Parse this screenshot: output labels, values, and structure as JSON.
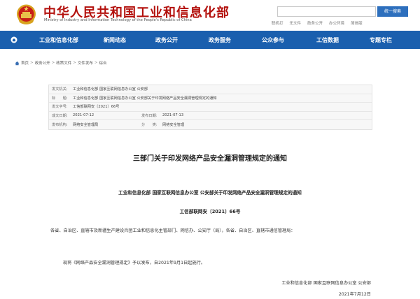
{
  "header": {
    "title": "中华人民共和国工业和信息化部",
    "subtitle": "Ministry of Industry and Information Technology of the People's Republic of China",
    "search_placeholder": "",
    "search_button": "统一搜索",
    "top_links": [
      "联机打",
      "无文件",
      "政务公开",
      "办公环境",
      "简体版"
    ]
  },
  "nav": {
    "items": [
      "工业和信息化部",
      "新闻动态",
      "政务公开",
      "政务服务",
      "公众参与",
      "工信数据",
      "专题专栏"
    ]
  },
  "breadcrumb": [
    "首页",
    "政务公开",
    "政策文件",
    "文件发布",
    "综合"
  ],
  "meta": {
    "issuer_label": "发文机关:",
    "issuer_value": "工业和信息化部 国家互联网信息办公室 公安部",
    "title_label": "标　　题:",
    "title_value": "工业和信息化部 国家互联网信息办公室 公安部关于印发网络产品安全漏洞管理规定的通知",
    "number_label": "发文字号:",
    "number_value": "工信部联网安〔2021〕66号",
    "date_label": "成文日期:",
    "date_value": "2021-07-12",
    "publish_label": "发布日期:",
    "publish_value": "2021-07-13",
    "dept_label": "发布机构:",
    "dept_value": "网络安全管理局",
    "category_label": "分　　类:",
    "category_value": "网络安全管理"
  },
  "article": {
    "title": "三部门关于印发网络产品安全漏洞管理规定的通知",
    "heading": "工业和信息化部 国家互联网信息办公室 公安部关于印发网络产品安全漏洞管理规定的通知",
    "doc_number": "工信部联网安〔2021〕66号",
    "recipients": "各省、自治区、直辖市及新疆生产建设兵团工业和信息化主管部门、网信办、公安厅（局），各省、自治区、直辖市通信管理局：",
    "body": "现将《网络产品安全漏洞管理规定》予以发布，自2021年9月1日起施行。",
    "issuers": "工业和信息化部 国家互联网信息办公室 公安部",
    "date": "2021年7月12日"
  },
  "colors": {
    "brand_red": "#b3100c",
    "nav_blue": "#1a5fae",
    "button_blue": "#2d6fbd"
  }
}
